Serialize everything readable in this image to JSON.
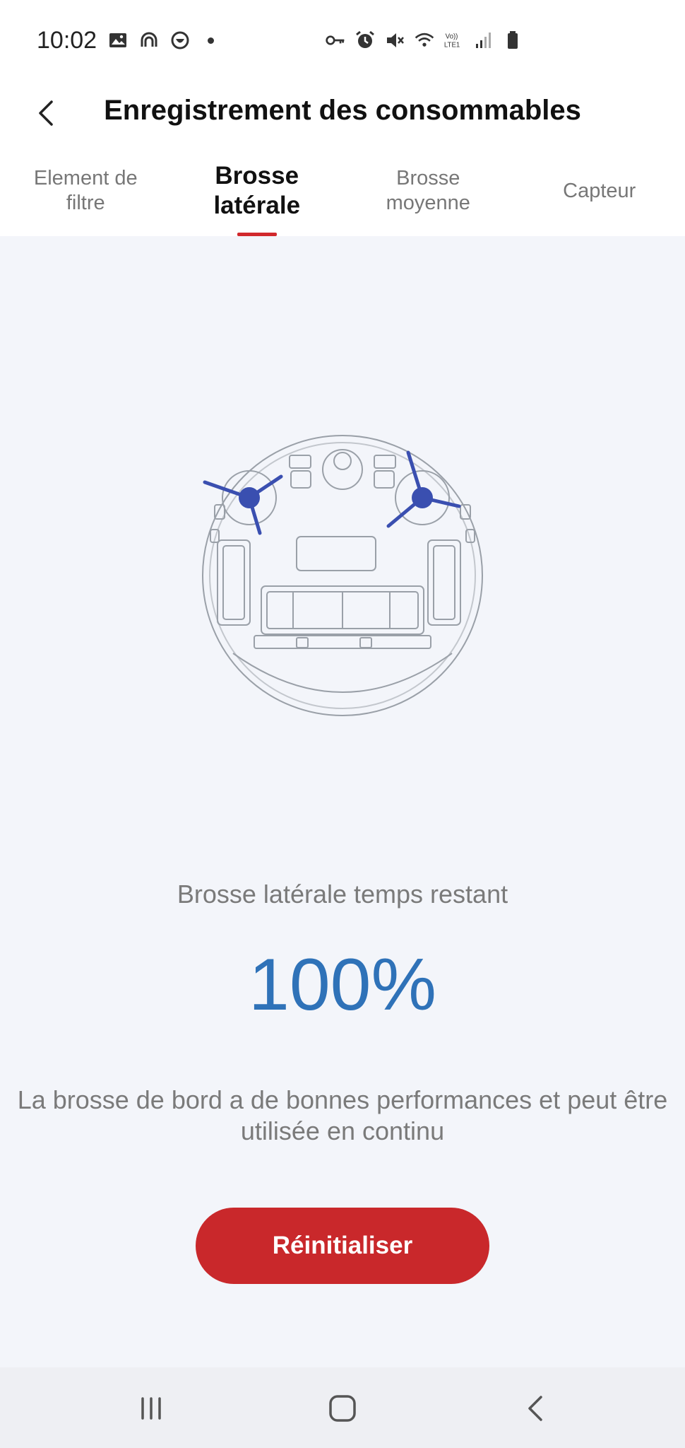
{
  "status_bar": {
    "time": "10:02",
    "left_icons": [
      "image-icon",
      "headphones-icon",
      "shield-check-icon",
      "dot-icon"
    ],
    "right_icons": [
      "key-icon",
      "alarm-icon",
      "mute-icon",
      "wifi-icon",
      "volte-icon",
      "signal-icon",
      "battery-icon"
    ],
    "volte_label": "Vo))\nLTE1"
  },
  "header": {
    "title": "Enregistrement des consommables",
    "back_icon": "chevron-left-icon"
  },
  "tabs": [
    {
      "label": "Element de\nfiltre",
      "active": false
    },
    {
      "label": "Brosse\nlatérale",
      "active": true
    },
    {
      "label": "Brosse\nmoyenne",
      "active": false
    },
    {
      "label": "Capteur",
      "active": false
    }
  ],
  "main": {
    "illustration": "robot-vacuum-bottom-view",
    "remaining_label": "Brosse latérale temps restant",
    "remaining_percent": "100%",
    "remaining_fraction": 1.0,
    "description": "La brosse de bord a de bonnes performances et peut être utilisée en continu",
    "reset_label": "Réinitialiser"
  },
  "colors": {
    "accent_red": "#c9282b",
    "value_blue": "#2f72b8",
    "brush_blue": "#3a4fb0",
    "background": "#f3f5fa"
  },
  "nav_bar": {
    "icons": [
      "recent-apps-icon",
      "home-icon",
      "back-icon"
    ]
  }
}
